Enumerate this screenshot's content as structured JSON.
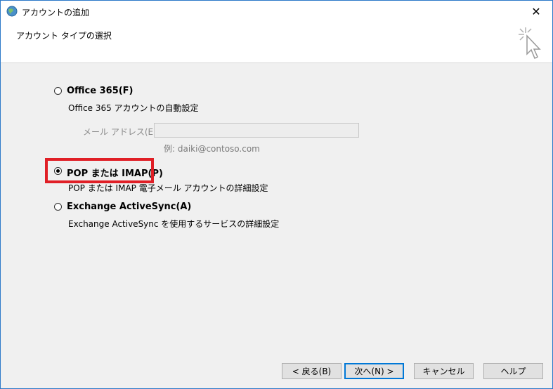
{
  "window": {
    "title": "アカウントの追加",
    "close_glyph": "✕"
  },
  "header": {
    "title": "アカウント タイプの選択"
  },
  "options": {
    "office365": {
      "label": "Office 365(F)",
      "desc": "Office 365 アカウントの自動設定",
      "selected": false
    },
    "email_label": "メール アドレス(E):",
    "email_value": "",
    "email_hint": "例: daiki@contoso.com",
    "pop": {
      "label": "POP または IMAP(P)",
      "desc": "POP または IMAP 電子メール アカウントの詳細設定",
      "selected": true
    },
    "exchange": {
      "label": "Exchange ActiveSync(A)",
      "desc": "Exchange ActiveSync を使用するサービスの詳細設定",
      "selected": false
    }
  },
  "buttons": {
    "back": "< 戻る(B)",
    "next": "次へ(N) >",
    "cancel": "キャンセル",
    "help": "ヘルプ"
  },
  "colors": {
    "highlight": "#e01f26",
    "accent": "#0078d7"
  }
}
